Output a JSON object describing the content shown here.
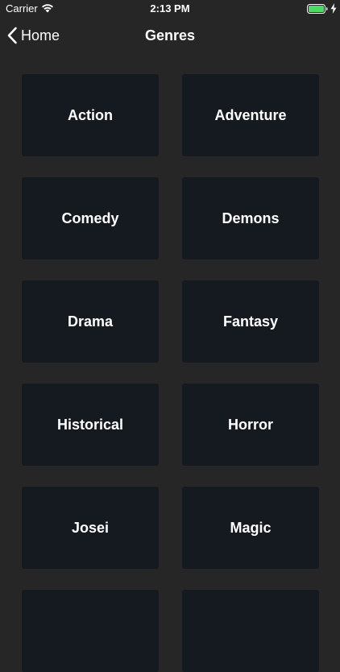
{
  "status_bar": {
    "carrier": "Carrier",
    "time": "2:13 PM",
    "battery_color": "#4cd964"
  },
  "nav": {
    "back_label": "Home",
    "title": "Genres"
  },
  "genres": [
    {
      "label": "Action"
    },
    {
      "label": "Adventure"
    },
    {
      "label": "Comedy"
    },
    {
      "label": "Demons"
    },
    {
      "label": "Drama"
    },
    {
      "label": "Fantasy"
    },
    {
      "label": "Historical"
    },
    {
      "label": "Horror"
    },
    {
      "label": "Josei"
    },
    {
      "label": "Magic"
    },
    {
      "label": ""
    },
    {
      "label": ""
    }
  ],
  "colors": {
    "background": "#262626",
    "tile": "#151a21",
    "text": "#ffffff"
  }
}
